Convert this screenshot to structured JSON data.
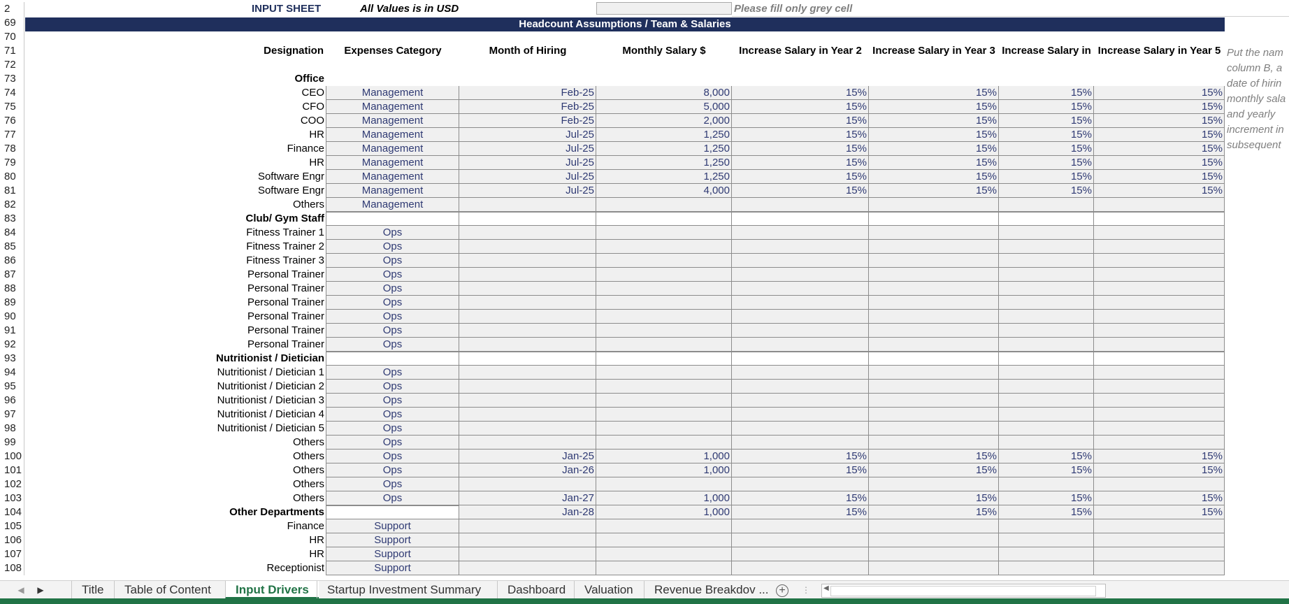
{
  "sheet": {
    "input_label": "INPUT SHEET",
    "values_note": "All Values is in USD",
    "fill_note": "Please fill only grey cell",
    "section_title": "Headcount Assumptions / Team & Salaries",
    "side_note": [
      "Put the nam",
      "column B, a",
      "date of hirin",
      "monthly sala",
      "and yearly",
      "increment in",
      "subsequent"
    ],
    "headers": {
      "designation": "Designation",
      "expenses_category": "Expenses Category",
      "month_of_hiring": "Month of Hiring",
      "monthly_salary": "Monthly Salary $",
      "inc_y2": "Increase Salary in Year 2",
      "inc_y3": "Increase Salary in Year 3",
      "inc_y4": "Increase Salary in",
      "inc_y5": "Increase Salary in Year 5"
    },
    "rows": [
      {
        "n": "2",
        "kind": "top"
      },
      {
        "n": "69",
        "kind": "title"
      },
      {
        "n": "70",
        "kind": "blank"
      },
      {
        "n": "71",
        "kind": "header"
      },
      {
        "n": "72",
        "kind": "blank"
      },
      {
        "n": "73",
        "kind": "section",
        "label": "Office"
      },
      {
        "n": "74",
        "kind": "data",
        "label": "CEO",
        "cat": "Management",
        "month": "Feb-25",
        "salary": "8,000",
        "y2": "15%",
        "y3": "15%",
        "y4": "15%",
        "y5": "15%"
      },
      {
        "n": "75",
        "kind": "data",
        "label": "CFO",
        "cat": "Management",
        "month": "Feb-25",
        "salary": "5,000",
        "y2": "15%",
        "y3": "15%",
        "y4": "15%",
        "y5": "15%"
      },
      {
        "n": "76",
        "kind": "data",
        "label": "COO",
        "cat": "Management",
        "month": "Feb-25",
        "salary": "2,000",
        "y2": "15%",
        "y3": "15%",
        "y4": "15%",
        "y5": "15%"
      },
      {
        "n": "77",
        "kind": "data",
        "label": "HR",
        "cat": "Management",
        "month": "Jul-25",
        "salary": "1,250",
        "y2": "15%",
        "y3": "15%",
        "y4": "15%",
        "y5": "15%"
      },
      {
        "n": "78",
        "kind": "data",
        "label": "Finance",
        "cat": "Management",
        "month": "Jul-25",
        "salary": "1,250",
        "y2": "15%",
        "y3": "15%",
        "y4": "15%",
        "y5": "15%"
      },
      {
        "n": "79",
        "kind": "data",
        "label": "HR",
        "cat": "Management",
        "month": "Jul-25",
        "salary": "1,250",
        "y2": "15%",
        "y3": "15%",
        "y4": "15%",
        "y5": "15%"
      },
      {
        "n": "80",
        "kind": "data",
        "label": "Software Engr",
        "cat": "Management",
        "month": "Jul-25",
        "salary": "1,250",
        "y2": "15%",
        "y3": "15%",
        "y4": "15%",
        "y5": "15%"
      },
      {
        "n": "81",
        "kind": "data",
        "label": "Software Engr",
        "cat": "Management",
        "month": "Jul-25",
        "salary": "4,000",
        "y2": "15%",
        "y3": "15%",
        "y4": "15%",
        "y5": "15%"
      },
      {
        "n": "82",
        "kind": "data",
        "label": "Others",
        "cat": "Management",
        "month": "",
        "salary": "",
        "y2": "",
        "y3": "",
        "y4": "",
        "y5": ""
      },
      {
        "n": "83",
        "kind": "section-grid",
        "label": "Club/ Gym Staff"
      },
      {
        "n": "84",
        "kind": "data",
        "label": "Fitness Trainer 1",
        "cat": "Ops",
        "month": "",
        "salary": "",
        "y2": "",
        "y3": "",
        "y4": "",
        "y5": ""
      },
      {
        "n": "85",
        "kind": "data",
        "label": "Fitness Trainer 2",
        "cat": "Ops",
        "month": "",
        "salary": "",
        "y2": "",
        "y3": "",
        "y4": "",
        "y5": ""
      },
      {
        "n": "86",
        "kind": "data",
        "label": "Fitness Trainer 3",
        "cat": "Ops",
        "month": "",
        "salary": "",
        "y2": "",
        "y3": "",
        "y4": "",
        "y5": ""
      },
      {
        "n": "87",
        "kind": "data",
        "label": "Personal Trainer",
        "cat": "Ops",
        "month": "",
        "salary": "",
        "y2": "",
        "y3": "",
        "y4": "",
        "y5": ""
      },
      {
        "n": "88",
        "kind": "data",
        "label": "Personal Trainer",
        "cat": "Ops",
        "month": "",
        "salary": "",
        "y2": "",
        "y3": "",
        "y4": "",
        "y5": ""
      },
      {
        "n": "89",
        "kind": "data",
        "label": "Personal Trainer",
        "cat": "Ops",
        "month": "",
        "salary": "",
        "y2": "",
        "y3": "",
        "y4": "",
        "y5": ""
      },
      {
        "n": "90",
        "kind": "data",
        "label": "Personal Trainer",
        "cat": "Ops",
        "month": "",
        "salary": "",
        "y2": "",
        "y3": "",
        "y4": "",
        "y5": ""
      },
      {
        "n": "91",
        "kind": "data",
        "label": "Personal Trainer",
        "cat": "Ops",
        "month": "",
        "salary": "",
        "y2": "",
        "y3": "",
        "y4": "",
        "y5": ""
      },
      {
        "n": "92",
        "kind": "data",
        "label": "Personal Trainer",
        "cat": "Ops",
        "month": "",
        "salary": "",
        "y2": "",
        "y3": "",
        "y4": "",
        "y5": ""
      },
      {
        "n": "93",
        "kind": "section-grid",
        "label": "Nutritionist / Dietician"
      },
      {
        "n": "94",
        "kind": "data",
        "label": "Nutritionist / Dietician 1",
        "cat": "Ops",
        "month": "",
        "salary": "",
        "y2": "",
        "y3": "",
        "y4": "",
        "y5": ""
      },
      {
        "n": "95",
        "kind": "data",
        "label": "Nutritionist / Dietician 2",
        "cat": "Ops",
        "month": "",
        "salary": "",
        "y2": "",
        "y3": "",
        "y4": "",
        "y5": ""
      },
      {
        "n": "96",
        "kind": "data",
        "label": "Nutritionist / Dietician 3",
        "cat": "Ops",
        "month": "",
        "salary": "",
        "y2": "",
        "y3": "",
        "y4": "",
        "y5": ""
      },
      {
        "n": "97",
        "kind": "data",
        "label": "Nutritionist / Dietician 4",
        "cat": "Ops",
        "month": "",
        "salary": "",
        "y2": "",
        "y3": "",
        "y4": "",
        "y5": ""
      },
      {
        "n": "98",
        "kind": "data",
        "label": "Nutritionist / Dietician 5",
        "cat": "Ops",
        "month": "",
        "salary": "",
        "y2": "",
        "y3": "",
        "y4": "",
        "y5": ""
      },
      {
        "n": "99",
        "kind": "data",
        "label": "Others",
        "cat": "Ops",
        "month": "",
        "salary": "",
        "y2": "",
        "y3": "",
        "y4": "",
        "y5": ""
      },
      {
        "n": "100",
        "kind": "data",
        "label": "Others",
        "cat": "Ops",
        "month": "Jan-25",
        "salary": "1,000",
        "y2": "15%",
        "y3": "15%",
        "y4": "15%",
        "y5": "15%"
      },
      {
        "n": "101",
        "kind": "data",
        "label": "Others",
        "cat": "Ops",
        "month": "Jan-26",
        "salary": "1,000",
        "y2": "15%",
        "y3": "15%",
        "y4": "15%",
        "y5": "15%"
      },
      {
        "n": "102",
        "kind": "data",
        "label": "Others",
        "cat": "Ops",
        "month": "",
        "salary": "",
        "y2": "",
        "y3": "",
        "y4": "",
        "y5": ""
      },
      {
        "n": "103",
        "kind": "data",
        "label": "Others",
        "cat": "Ops",
        "month": "Jan-27",
        "salary": "1,000",
        "y2": "15%",
        "y3": "15%",
        "y4": "15%",
        "y5": "15%"
      },
      {
        "n": "104",
        "kind": "section-data",
        "label": "Other Departments",
        "cat": "",
        "month": "Jan-28",
        "salary": "1,000",
        "y2": "15%",
        "y3": "15%",
        "y4": "15%",
        "y5": "15%"
      },
      {
        "n": "105",
        "kind": "data",
        "label": "Finance",
        "cat": "Support",
        "month": "",
        "salary": "",
        "y2": "",
        "y3": "",
        "y4": "",
        "y5": ""
      },
      {
        "n": "106",
        "kind": "data",
        "label": "HR",
        "cat": "Support",
        "month": "",
        "salary": "",
        "y2": "",
        "y3": "",
        "y4": "",
        "y5": ""
      },
      {
        "n": "107",
        "kind": "data",
        "label": "HR",
        "cat": "Support",
        "month": "",
        "salary": "",
        "y2": "",
        "y3": "",
        "y4": "",
        "y5": ""
      },
      {
        "n": "108",
        "kind": "data",
        "label": "Receptionist",
        "cat": "Support",
        "month": "",
        "salary": "",
        "y2": "",
        "y3": "",
        "y4": "",
        "y5": ""
      }
    ]
  },
  "tabs": {
    "items": [
      "Title",
      "Table of Content",
      "Input Drivers",
      "Startup Investment Summary",
      "Dashboard",
      "Valuation",
      "Revenue Breakdov ..."
    ],
    "active": "Input Drivers",
    "add_icon": "plus-circle-icon"
  },
  "colors": {
    "title_bar": "#1f2f5c",
    "input_value_text": "#2f3a73",
    "grey_input": "#f0f0f0",
    "excel_green": "#217346"
  }
}
